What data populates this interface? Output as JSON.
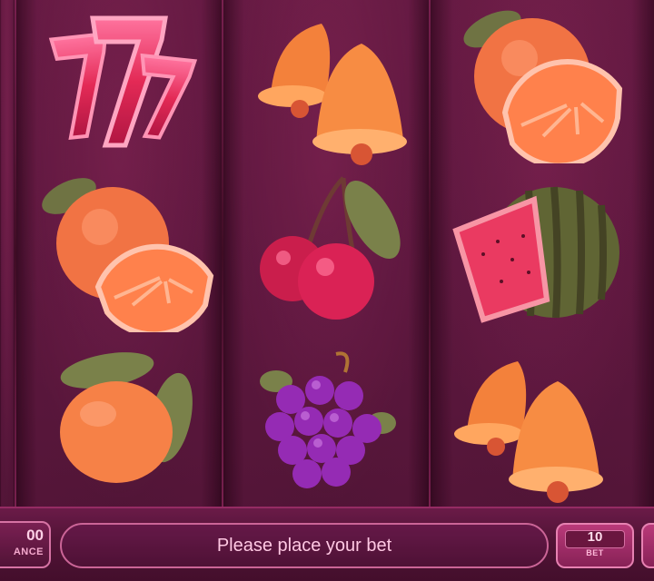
{
  "colors": {
    "background": "#3a0f2a",
    "accent": "#c66a98",
    "text": "#ffd8ec"
  },
  "reels": [
    {
      "name": "reel-1",
      "symbols": [
        {
          "kind": "seven",
          "icon": "lucky-seven-icon"
        },
        {
          "kind": "orange",
          "icon": "orange-icon"
        },
        {
          "kind": "lemon",
          "icon": "lemon-icon"
        }
      ]
    },
    {
      "name": "reel-2",
      "symbols": [
        {
          "kind": "bell",
          "icon": "bell-icon"
        },
        {
          "kind": "cherry",
          "icon": "cherry-icon"
        },
        {
          "kind": "grapes",
          "icon": "grapes-icon"
        }
      ]
    },
    {
      "name": "reel-3",
      "symbols": [
        {
          "kind": "orange",
          "icon": "orange-icon"
        },
        {
          "kind": "watermelon",
          "icon": "watermelon-icon"
        },
        {
          "kind": "bell",
          "icon": "bell-icon"
        }
      ]
    }
  ],
  "bottom_bar": {
    "balance_value": "00",
    "balance_label": "ANCE",
    "message": "Please place your bet",
    "bet_value": "10",
    "bet_label": "BET"
  }
}
